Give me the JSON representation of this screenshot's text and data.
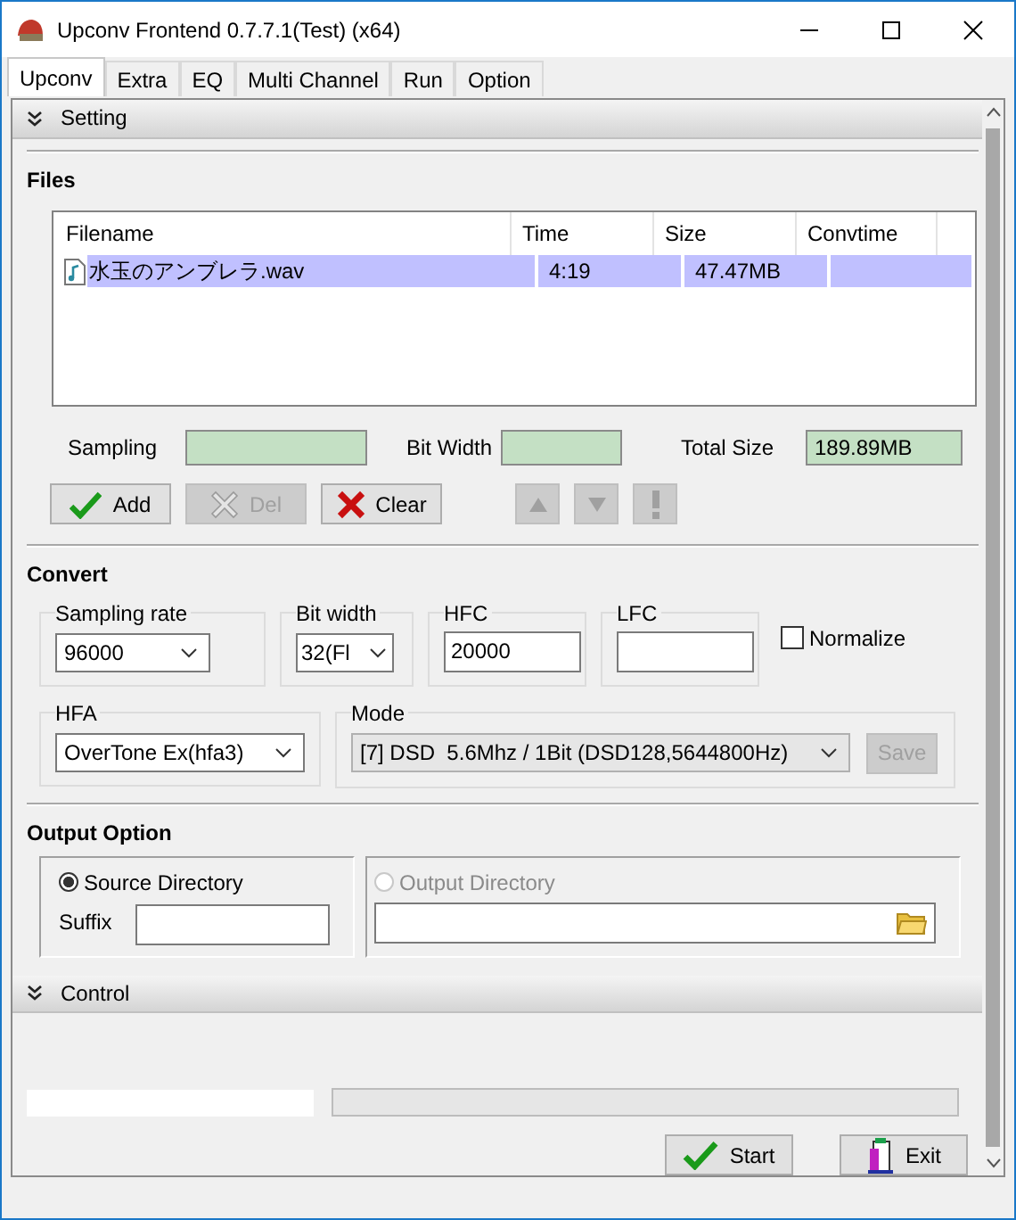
{
  "window": {
    "title": "Upconv Frontend 0.7.7.1(Test) (x64)"
  },
  "tabs": [
    {
      "label": "Upconv",
      "selected": true
    },
    {
      "label": "Extra",
      "selected": false
    },
    {
      "label": "EQ",
      "selected": false
    },
    {
      "label": "Multi Channel",
      "selected": false
    },
    {
      "label": "Run",
      "selected": false
    },
    {
      "label": "Option",
      "selected": false
    }
  ],
  "setting_header": {
    "label": "Setting"
  },
  "files": {
    "heading": "Files",
    "columns": [
      "Filename",
      "Time",
      "Size",
      "Convtime"
    ],
    "rows": [
      {
        "filename": "水玉のアンブレラ.wav",
        "time": "4:19",
        "size": "47.47MB",
        "selected": true
      }
    ],
    "sampling": {
      "label": "Sampling"
    },
    "bit_width": {
      "label": "Bit Width"
    },
    "total_size": {
      "label": "Total Size",
      "value": "189.89MB"
    },
    "buttons": [
      {
        "label": "Add",
        "kind": "check",
        "disabled": false
      },
      {
        "label": "Del",
        "kind": "cross",
        "disabled": true
      },
      {
        "label": "Clear",
        "kind": "cross",
        "disabled": false
      }
    ],
    "order_buttons": [
      {
        "kind": "up",
        "disabled": true
      },
      {
        "kind": "down",
        "disabled": true
      },
      {
        "kind": "exclaim",
        "disabled": true
      }
    ]
  },
  "convert": {
    "heading": "Convert",
    "sampling_rate": {
      "label": "Sampling rate",
      "value": "96000"
    },
    "bit_width": {
      "label": "Bit width",
      "value": "32(Fl"
    },
    "hfc": {
      "label": "HFC",
      "value": "20000"
    },
    "lfc": {
      "label": "LFC"
    },
    "normalize": {
      "label": "Normalize",
      "checked": false
    },
    "hfa": {
      "label": "HFA",
      "value": "OverTone Ex(hfa3)"
    },
    "mode": {
      "label": "Mode",
      "value": "[7] DSD  5.6Mhz / 1Bit (DSD128,5644800Hz)"
    },
    "save_button": {
      "label": "Save",
      "disabled": true
    }
  },
  "output": {
    "heading": "Output Option",
    "source": {
      "label": "Source Directory",
      "selected": true,
      "disabled": false,
      "suffix_label": "Suffix"
    },
    "directory": {
      "label": "Output Directory",
      "selected": false,
      "disabled": true
    }
  },
  "control_header": {
    "label": "Control"
  },
  "progress": {
    "level": 0
  },
  "control_buttons": [
    {
      "label": "Start",
      "kind": "check"
    },
    {
      "label": "Exit",
      "kind": "exit"
    }
  ]
}
